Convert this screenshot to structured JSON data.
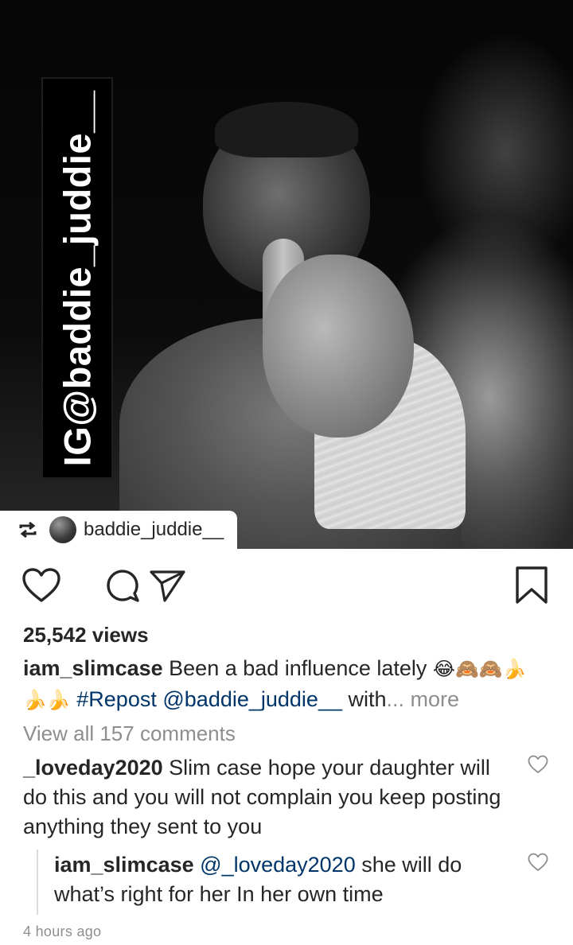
{
  "media": {
    "watermark": "IG@baddie_juddie__",
    "repost_username": "baddie_juddie__"
  },
  "actions": {
    "like_icon": "heart-outline-icon",
    "comment_icon": "comment-bubble-icon",
    "share_icon": "paper-plane-icon",
    "save_icon": "bookmark-outline-icon"
  },
  "post": {
    "views": "25,542 views",
    "caption_username": "iam_slimcase",
    "caption_text": "Been a bad influence lately",
    "caption_emojis_1": "😂🙈🙈🍌",
    "caption_emojis_2": "🍌🍌",
    "caption_hashtag": "#Repost",
    "caption_mention": "@baddie_juddie__",
    "caption_tail": "with",
    "caption_more": "... more",
    "view_all_comments": "View all 157 comments"
  },
  "comments": [
    {
      "username": "_loveday2020",
      "text": "Slim case  hope your daughter will do this and you will not complain you keep posting anything they sent to you"
    }
  ],
  "reply": {
    "username": "iam_slimcase",
    "mention": "@_loveday2020",
    "text": "she will do what’s right for her In her own time"
  },
  "timestamp": "4 hours ago",
  "colors": {
    "text": "#262626",
    "secondary": "#8e8e8e",
    "link": "#003569"
  }
}
